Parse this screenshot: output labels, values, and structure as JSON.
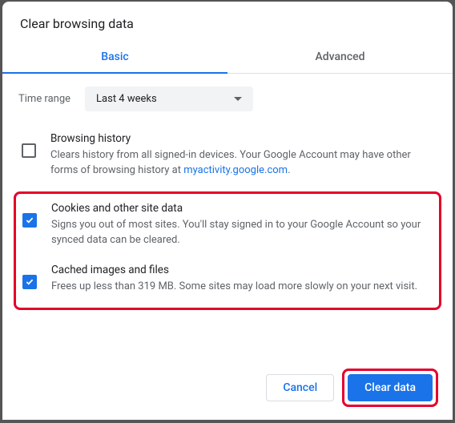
{
  "dialog": {
    "title": "Clear browsing data"
  },
  "tabs": {
    "basic": "Basic",
    "advanced": "Advanced",
    "active": "basic"
  },
  "time_range": {
    "label": "Time range",
    "value": "Last 4 weeks"
  },
  "items": {
    "browsing": {
      "checked": false,
      "title": "Browsing history",
      "desc_prefix": "Clears history from all signed-in devices. Your Google Account may have other forms of browsing history at ",
      "link_text": "myactivity.google.com",
      "desc_suffix": "."
    },
    "cookies": {
      "checked": true,
      "title": "Cookies and other site data",
      "desc": "Signs you out of most sites. You'll stay signed in to your Google Account so your synced data can be cleared."
    },
    "cache": {
      "checked": true,
      "title": "Cached images and files",
      "desc": "Frees up less than 319 MB. Some sites may load more slowly on your next visit."
    }
  },
  "buttons": {
    "cancel": "Cancel",
    "clear": "Clear data"
  },
  "colors": {
    "accent": "#1a73e8",
    "highlight": "#e4002b"
  }
}
